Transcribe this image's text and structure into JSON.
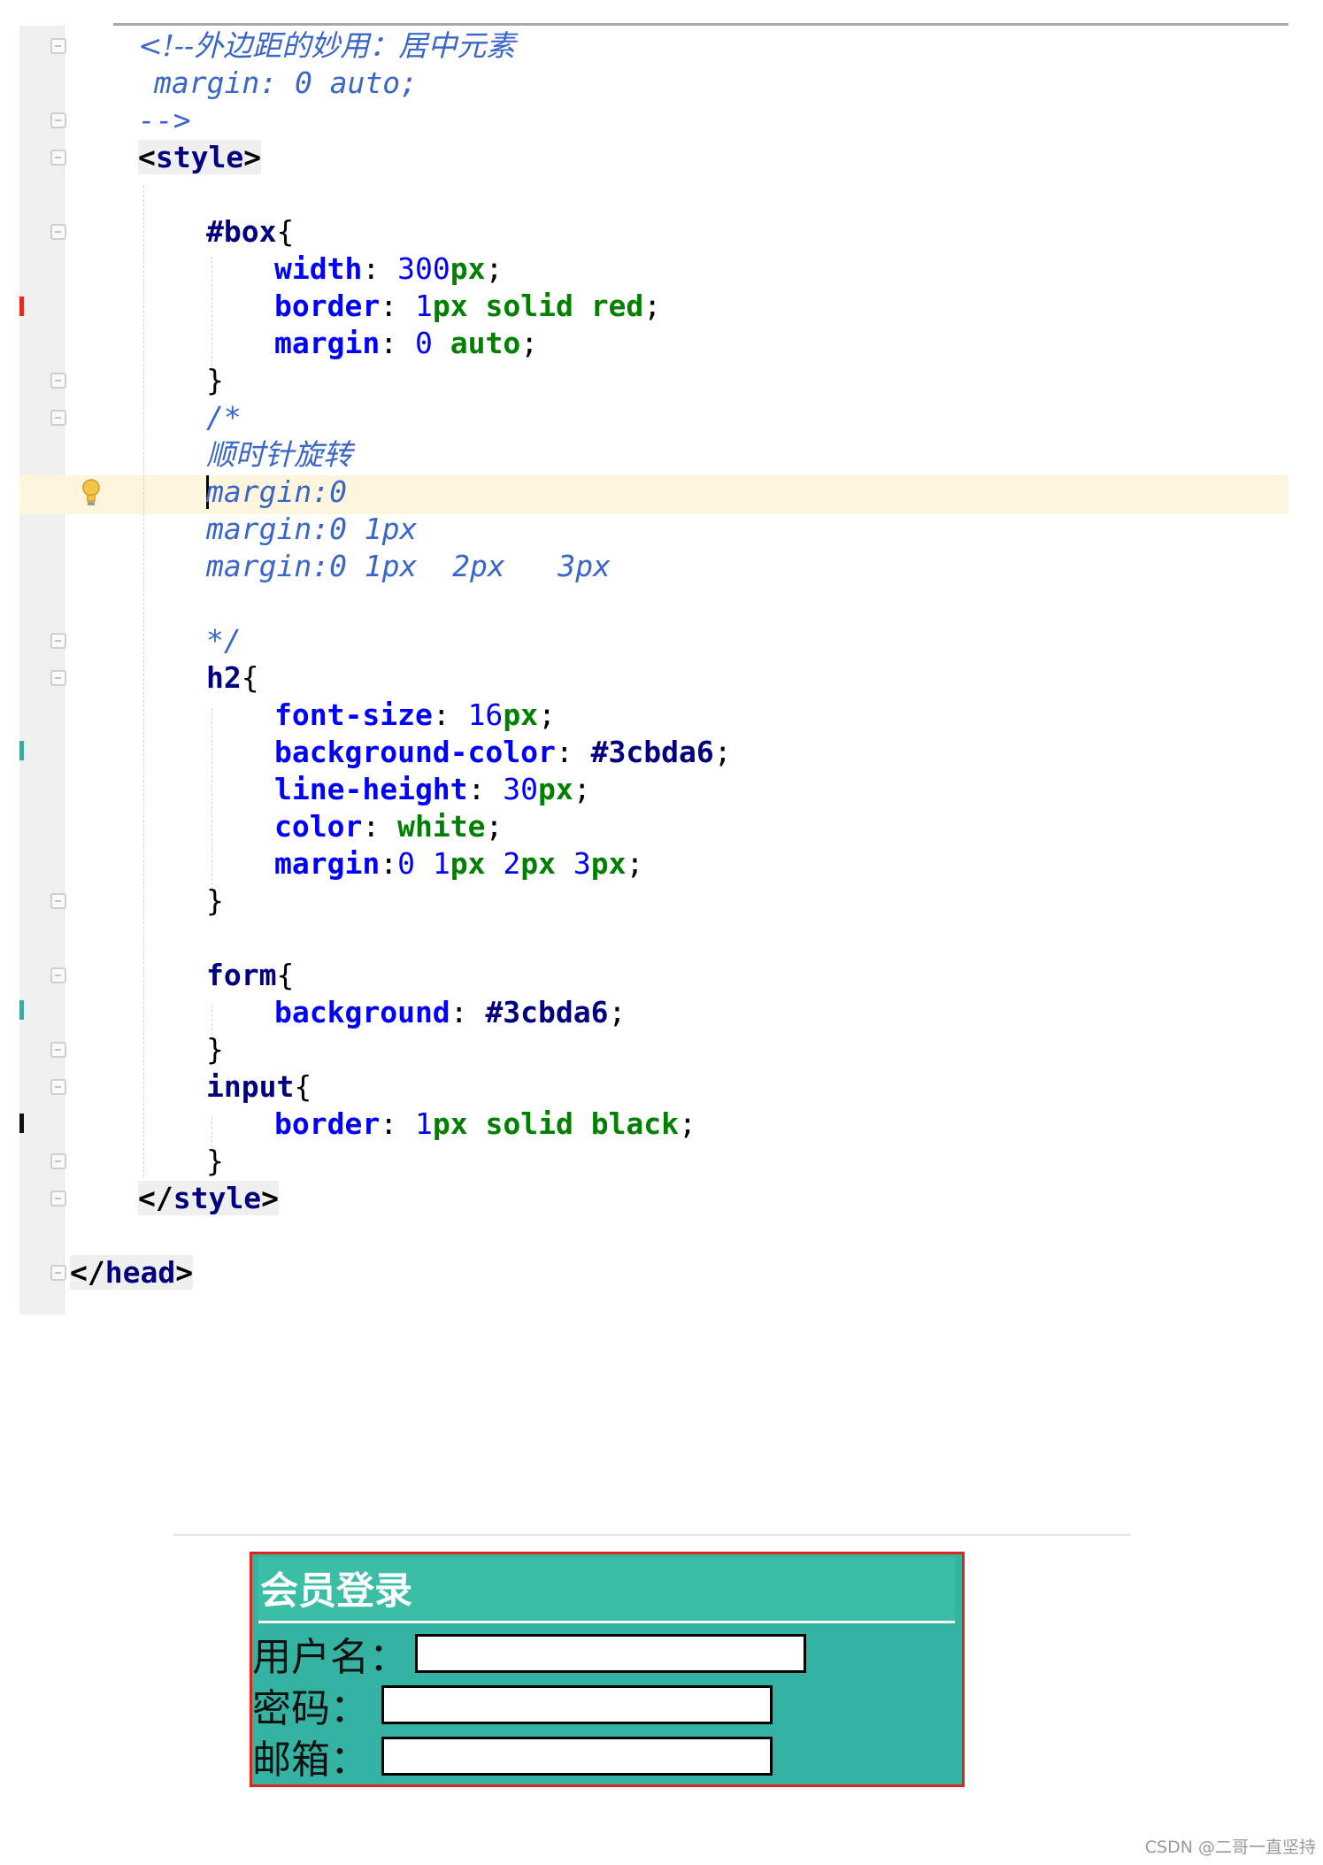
{
  "editor": {
    "lines": {
      "l01": {
        "pre": "",
        "text": "<!--外边距的妙用：居中元素"
      },
      "l02": {
        "text": "margin: 0 auto;"
      },
      "l03": {
        "text": "-->"
      },
      "l04": {
        "open": "<",
        "name": "style",
        "close": ">"
      },
      "l06": {
        "sel": "#box",
        "brace": "{"
      },
      "l07": {
        "prop": "width",
        "colon": ": ",
        "num": "300",
        "unit": "px",
        "semi": ";"
      },
      "l08": {
        "prop": "border",
        "colon": ": ",
        "num": "1",
        "unit": "px",
        "v1": "solid",
        "v2": "red",
        "semi": ";"
      },
      "l09": {
        "prop": "margin",
        "colon": ": ",
        "num": "0",
        "v1": "auto",
        "semi": ";"
      },
      "l10": {
        "text": "}"
      },
      "l11": {
        "text": "/*"
      },
      "l12": {
        "text": "顺时针旋转"
      },
      "l13": {
        "text": "margin:0"
      },
      "l14": {
        "text": "margin:0 1px"
      },
      "l15": {
        "text": "margin:0 1px  2px   3px"
      },
      "l17": {
        "text": "*/"
      },
      "l18": {
        "sel": "h2",
        "brace": "{"
      },
      "l19": {
        "prop": "font-size",
        "colon": ": ",
        "num": "16",
        "unit": "px",
        "semi": ";"
      },
      "l20": {
        "prop": "background-color",
        "colon": ": ",
        "hex": "#3cbda6",
        "semi": ";"
      },
      "l21": {
        "prop": "line-height",
        "colon": ": ",
        "num": "30",
        "unit": "px",
        "semi": ";"
      },
      "l22": {
        "prop": "color",
        "colon": ": ",
        "v1": "white",
        "semi": ";"
      },
      "l23": {
        "prop": "margin",
        "colon": ":",
        "n1": "0",
        "n2": "1",
        "u2": "px",
        "n3": "2",
        "u3": "px",
        "n4": "3",
        "u4": "px",
        "semi": ";"
      },
      "l24": {
        "text": "}"
      },
      "l26": {
        "sel": "form",
        "brace": "{"
      },
      "l27": {
        "prop": "background",
        "colon": ": ",
        "hex": "#3cbda6",
        "semi": ";"
      },
      "l28": {
        "text": "}"
      },
      "l29": {
        "sel": "input",
        "brace": "{"
      },
      "l30": {
        "prop": "border",
        "colon": ": ",
        "num": "1",
        "unit": "px",
        "v1": "solid",
        "v2": "black",
        "semi": ";"
      },
      "l31": {
        "text": "}"
      },
      "l32": {
        "open": "</",
        "name": "style",
        "close": ">"
      },
      "l34": {
        "open": "</",
        "name": "head",
        "close": ">"
      }
    },
    "colors": {
      "keyword": "#000080",
      "property": "#0000ff",
      "value": "#008000",
      "comment": "#3a66cc",
      "current_line": "#fdf6dd"
    },
    "icons": [
      "fold-icon",
      "lightbulb-icon"
    ]
  },
  "preview": {
    "heading": "会员登录",
    "fields": [
      {
        "label": "用户名：",
        "value": ""
      },
      {
        "label": "密码：",
        "value": ""
      },
      {
        "label": "邮箱：",
        "value": ""
      }
    ],
    "colors": {
      "form_bg": "#3cbda6",
      "box_border": "red",
      "input_border": "black"
    }
  },
  "watermark": "CSDN @二哥一直坚持"
}
